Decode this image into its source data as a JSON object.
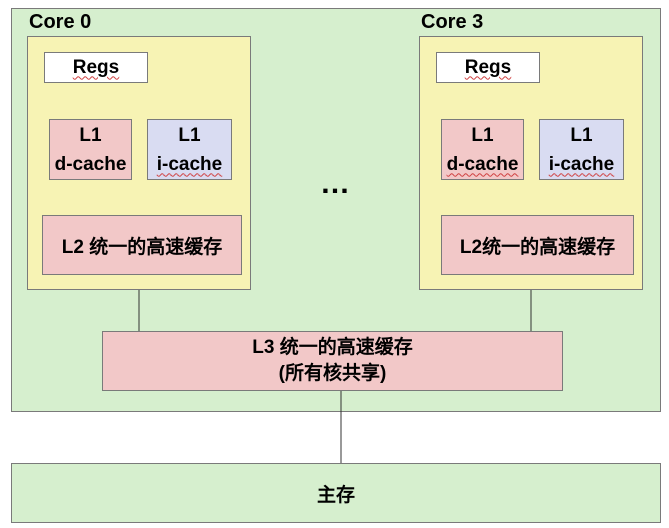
{
  "cores": [
    {
      "label": "Core 0",
      "regs": "Regs",
      "l1d": [
        "L1",
        "d-cache"
      ],
      "l1i": [
        "L1",
        "i-cache"
      ],
      "l2": "L2 统一的高速缓存"
    },
    {
      "label": "Core 3",
      "regs": "Regs",
      "l1d": [
        "L1",
        "d-cache"
      ],
      "l1i": [
        "L1",
        "i-cache"
      ],
      "l2": "L2统一的高速缓存"
    }
  ],
  "ellipsis": "…",
  "l3": {
    "line1": "L3 统一的高速缓存",
    "line2": "(所有核共享)"
  },
  "main_memory": "主存",
  "colors": {
    "chip": "#d6efce",
    "core": "#f7f3b4",
    "cache_pink": "#f2c8c8",
    "icache_lavender": "#d9dcf2",
    "regs": "#ffffff"
  }
}
